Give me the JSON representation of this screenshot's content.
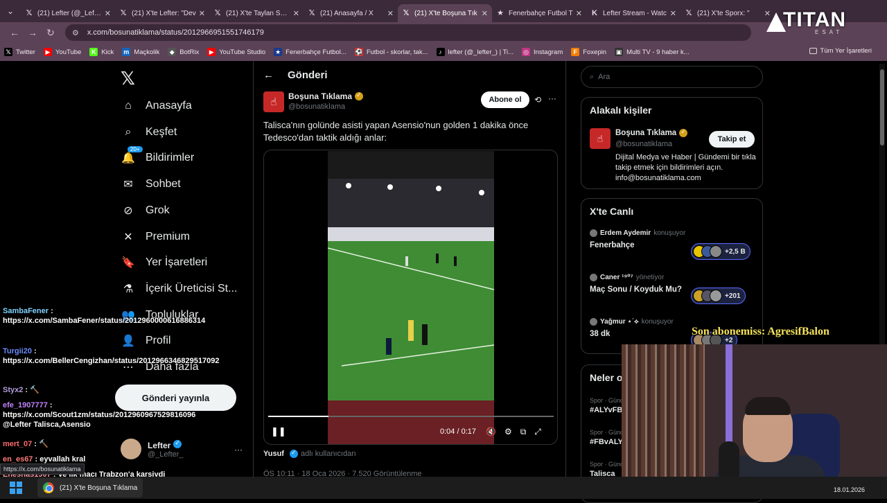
{
  "browser": {
    "tabs": [
      {
        "icon": "x-icon",
        "title": "(21) Lefter (@_Lefter",
        "active": false
      },
      {
        "icon": "x-icon",
        "title": "(21) X'te Lefter: \"Dev",
        "active": false
      },
      {
        "icon": "x-icon",
        "title": "(21) X'te Taylan Sedo",
        "active": false
      },
      {
        "icon": "x-icon",
        "title": "(21) Anasayfa / X",
        "active": false
      },
      {
        "icon": "x-icon",
        "title": "(21) X'te Boşuna Tık",
        "active": true
      },
      {
        "icon": "fenerbahce-icon",
        "title": "Fenerbahçe Futbol T",
        "active": false
      },
      {
        "icon": "kick-icon",
        "title": "Lefter Stream - Watc",
        "active": false
      },
      {
        "icon": "x-icon",
        "title": "(21) X'te Sporx: \"",
        "active": false
      }
    ],
    "url": "x.com/bosunatiklama/status/2012966951551746179",
    "bookmarks": [
      {
        "icon": "x-icon",
        "label": "Twitter",
        "color": "#000000"
      },
      {
        "icon": "youtube-icon",
        "label": "YouTube",
        "color": "#ff0000"
      },
      {
        "icon": "kick-icon",
        "label": "Kick",
        "color": "#53fc18"
      },
      {
        "icon": "mackolik-icon",
        "label": "Maçkolik",
        "color": "#1565c0"
      },
      {
        "icon": "botrix-icon",
        "label": "BotRix",
        "color": "#555555"
      },
      {
        "icon": "youtube-icon",
        "label": "YouTube Studio",
        "color": "#ff0000"
      },
      {
        "icon": "fenerbahce-icon",
        "label": "Fenerbahçe Futbol...",
        "color": "#1b3a8c"
      },
      {
        "icon": "flashscore-icon",
        "label": "Futbol - skorlar, tak...",
        "color": "#d32f2f"
      },
      {
        "icon": "tiktok-icon",
        "label": "lefter (@_lefter_) | Ti...",
        "color": "#000000"
      },
      {
        "icon": "instagram-icon",
        "label": "Instagram",
        "color": "#c13584"
      },
      {
        "icon": "foxepin-icon",
        "label": "Foxepin",
        "color": "#f57c00"
      },
      {
        "icon": "multitv-icon",
        "label": "Multi TV - 9 haber k...",
        "color": "#333333"
      }
    ],
    "all_bookmarks": "Tüm Yer İşaretleri"
  },
  "nav": {
    "items": [
      {
        "icon": "home-icon",
        "label": "Anasayfa"
      },
      {
        "icon": "search-icon",
        "label": "Keşfet"
      },
      {
        "icon": "bell-icon",
        "label": "Bildirimler",
        "badge": "20+"
      },
      {
        "icon": "mail-icon",
        "label": "Sohbet"
      },
      {
        "icon": "grok-icon",
        "label": "Grok"
      },
      {
        "icon": "x-icon",
        "label": "Premium"
      },
      {
        "icon": "bookmark-icon",
        "label": "Yer İşaretleri"
      },
      {
        "icon": "flask-icon",
        "label": "İçerik Üreticisi St..."
      },
      {
        "icon": "people-icon",
        "label": "Topluluklar"
      },
      {
        "icon": "profile-icon",
        "label": "Profil"
      },
      {
        "icon": "more-icon",
        "label": "Daha fazla"
      }
    ],
    "post_button": "Gönderi yayınla",
    "account": {
      "name": "Lefter",
      "handle": "@_Lefter_"
    }
  },
  "post": {
    "header": "Gönderi",
    "author": {
      "name": "Boşuna Tıklama",
      "handle": "@bosunatiklama"
    },
    "subscribe": "Abone ol",
    "text": "Talisca'nın golünde asisti yapan Asensio'nun golden 1 dakika önce Tedesco'dan taktik aldığı anlar:",
    "video": {
      "time": "0:04 / 0:17",
      "progress": 0.21
    },
    "footer_user": "Yusuf",
    "footer_label": "adlı kullanıcıdan",
    "meta": "ÖS 10:11 · 18 Oca 2026 · 7.520 Görüntülenme"
  },
  "sidebar": {
    "search_placeholder": "Ara",
    "related_title": "Alakalı kişiler",
    "related": {
      "name": "Boşuna Tıklama",
      "handle": "@bosunatiklama",
      "follow": "Takip et",
      "bio": "Dijital Medya ve Haber | Gündemi bir tıkla takip etmek için bildirimleri açın. info@bosunatiklama.com"
    },
    "live_title": "X'te Canlı",
    "live": [
      {
        "user": "Erdem Aydemir",
        "role": "konuşuyor",
        "topic": "Fenerbahçe",
        "count": "+2,5 B"
      },
      {
        "user": "Caner ¹⁹⁰⁷",
        "role": "yönetiyor",
        "topic": "Maç Sonu / Koyduk Mu?",
        "count": "+201"
      },
      {
        "user": "Yağmur ⋆˙⟡",
        "role": "konuşuyor",
        "topic": "38 dk",
        "count": "+2"
      }
    ],
    "trends_title": "Neler oluyor",
    "trends": [
      {
        "cat": "Spor · Gündemde",
        "tag": "#ALYvFB"
      },
      {
        "cat": "Spor · Gündemde",
        "tag": "#FBvALY"
      },
      {
        "cat": "Spor · Gündemde",
        "tag": "Talisca"
      }
    ]
  },
  "chat": [
    {
      "user": "SambaFener",
      "msg": "https://x.com/SambaFener/status/2012960000616886314",
      "color": "#7fd3ff"
    },
    {
      "user": "Turgii20",
      "msg": "https://x.com/BellerCengizhan/status/2012966346829517092",
      "color": "#6a8cff"
    },
    {
      "user": "Styx2",
      "msg": "🔨",
      "color": "#b39ddb"
    },
    {
      "user": "efe_1907777",
      "msg": "https://x.com/Scout1zm/status/2012960967529816096 @Lefter Talisca,Asensio",
      "color": "#c084fc"
    },
    {
      "user": "mert_07",
      "msg": "🔨",
      "color": "#ff6b6b"
    },
    {
      "user": "en_es67",
      "msg": "eyvallah kral",
      "color": "#ff7a7a"
    },
    {
      "user": "Eneshas1907",
      "msg": "Ve ilk maçı Trabzon'a karsiydi",
      "color": "#ff9aa2"
    }
  ],
  "overlay": {
    "sub_text": "Son abonemiss: AgresifBalon",
    "brand": "TITAN",
    "brand_sub": "ESAT"
  },
  "status_url": "https://x.com/bosunatiklama",
  "taskbar": {
    "app": "(21) X'te Boşuna Tıklama",
    "date": "18.01.2026"
  }
}
